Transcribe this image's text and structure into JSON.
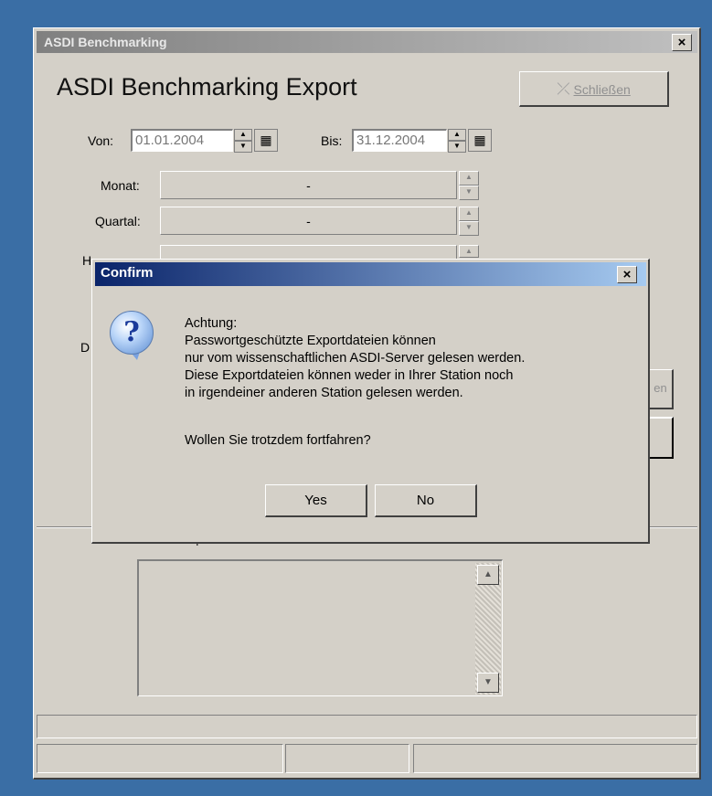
{
  "main_window": {
    "title": "ASDI Benchmarking",
    "close_glyph": "×",
    "heading": "ASDI Benchmarking Export",
    "close_button": {
      "label": "Schließen",
      "icon": "close-x-icon"
    }
  },
  "date_range": {
    "from_label": "Von:",
    "from_value": "01.01.2004",
    "to_label": "Bis:",
    "to_value": "31.12.2004",
    "calendar_icon": "calendar-icon"
  },
  "filters": [
    {
      "label": "Monat:",
      "value": "-"
    },
    {
      "label": "Quartal:",
      "value": "-"
    }
  ],
  "partial_labels": {
    "h": "H",
    "d": "D",
    "right_btn": "en"
  },
  "exported_files": {
    "label": "Bereits exportierte Dateien im Pfad",
    "items": []
  },
  "confirm_dialog": {
    "title": "Confirm",
    "close_glyph": "×",
    "icon": "question-icon",
    "message_lines": [
      "Achtung:",
      "Passwortgeschützte Exportdateien können",
      "nur vom wissenschaftlichen ASDI-Server gelesen werden.",
      "Diese Exportdateien können weder in Ihrer Station noch",
      "in irgendeiner anderen Station gelesen werden."
    ],
    "question": "Wollen Sie trotzdem fortfahren?",
    "yes_label": "Yes",
    "no_label": "No"
  }
}
